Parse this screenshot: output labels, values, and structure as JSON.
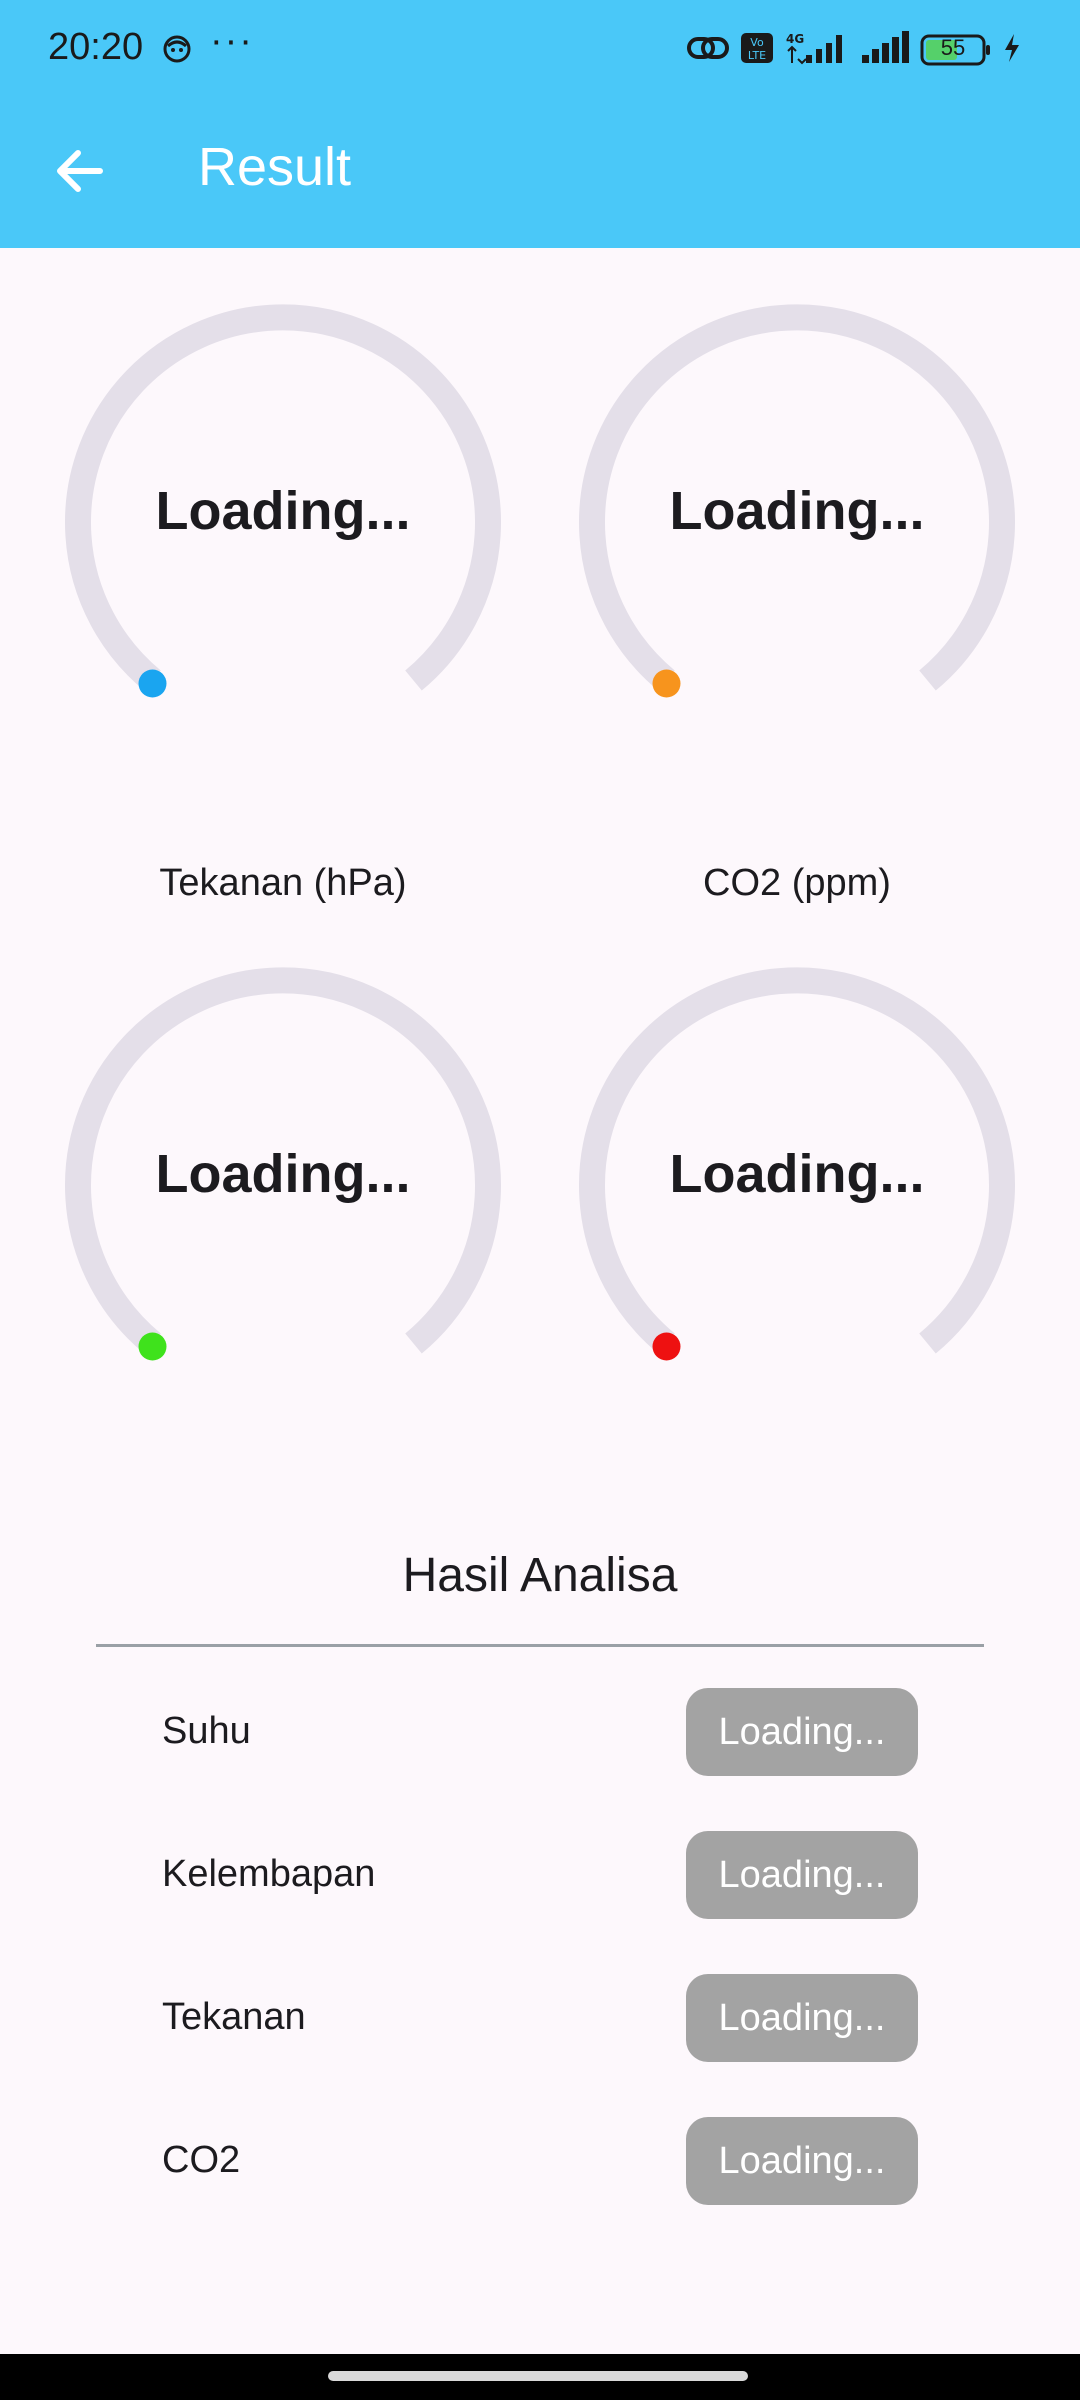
{
  "status_bar": {
    "time": "20:20",
    "overflow": "···",
    "network": "4G",
    "volte": "Vo LTE",
    "battery": "55",
    "icons": [
      "face-icon",
      "link-icon",
      "volte-icon",
      "signal-icon",
      "battery-icon",
      "charging-icon"
    ]
  },
  "app_bar": {
    "title": "Result",
    "back_icon": "arrow-left-icon",
    "background": "#4ac8f8"
  },
  "gauges": [
    {
      "value_text": "Loading...",
      "label": "",
      "indicator_color": "#1aa5f0"
    },
    {
      "value_text": "Loading...",
      "label": "",
      "indicator_color": "#f7941d"
    },
    {
      "value_text": "Loading...",
      "label": "Tekanan (hPa)",
      "indicator_color": "#3fe21c"
    },
    {
      "value_text": "Loading...",
      "label": "CO2 (ppm)",
      "indicator_color": "#ee1111"
    }
  ],
  "analysis": {
    "title": "Hasil Analisa",
    "rows": [
      {
        "label": "Suhu",
        "status": "Loading..."
      },
      {
        "label": "Kelembapan",
        "status": "Loading..."
      },
      {
        "label": "Tekanan",
        "status": "Loading..."
      },
      {
        "label": "CO2",
        "status": "Loading..."
      }
    ]
  }
}
